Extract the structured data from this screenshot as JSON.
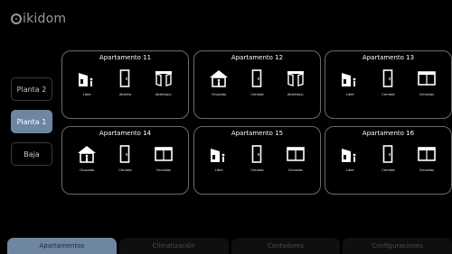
{
  "header": {
    "brand": "ikidom"
  },
  "floors": [
    {
      "label": "Planta 2",
      "active": false
    },
    {
      "label": "Planta 1",
      "active": true
    },
    {
      "label": "Baja",
      "active": false
    }
  ],
  "apartments": [
    {
      "title": "Apartamento 11",
      "icons": [
        {
          "icon": "person-leaving-house-icon",
          "label": "Libre"
        },
        {
          "icon": "door-icon",
          "label": "Abierta"
        },
        {
          "icon": "open-window-icon",
          "label": "Abierta(s)"
        }
      ]
    },
    {
      "title": "Apartamento 12",
      "icons": [
        {
          "icon": "house-person-icon",
          "label": "Ocupado"
        },
        {
          "icon": "door-icon",
          "label": "Cerrada"
        },
        {
          "icon": "open-window-icon",
          "label": "Abierta(s)"
        }
      ]
    },
    {
      "title": "Apartamento 13",
      "icons": [
        {
          "icon": "person-leaving-house-icon",
          "label": "Libre"
        },
        {
          "icon": "door-icon",
          "label": "Cerrada"
        },
        {
          "icon": "window-closed-icon",
          "label": "Cerradas"
        }
      ]
    },
    {
      "title": "Apartamento 14",
      "icons": [
        {
          "icon": "house-person-icon",
          "label": "Ocupado"
        },
        {
          "icon": "door-icon",
          "label": "Cerrada"
        },
        {
          "icon": "window-closed-icon",
          "label": "Cerradas"
        }
      ]
    },
    {
      "title": "Apartamento 15",
      "icons": [
        {
          "icon": "person-leaving-house-icon",
          "label": "Libre"
        },
        {
          "icon": "door-icon",
          "label": "Cerrada"
        },
        {
          "icon": "window-closed-icon",
          "label": "Cerradas"
        }
      ]
    },
    {
      "title": "Apartamento 16",
      "icons": [
        {
          "icon": "person-leaving-house-icon",
          "label": "Libre"
        },
        {
          "icon": "door-icon",
          "label": "Cerrada"
        },
        {
          "icon": "window-closed-icon",
          "label": "Cerradas"
        }
      ]
    }
  ],
  "tabs": [
    {
      "label": "Apartamentos",
      "active": true
    },
    {
      "label": "Climatización",
      "active": false
    },
    {
      "label": "Contadores",
      "active": false
    },
    {
      "label": "Configuraciones",
      "active": false
    }
  ],
  "colors": {
    "accent": "#6f86a3",
    "border": "#6a6a6a",
    "background": "#000000"
  }
}
